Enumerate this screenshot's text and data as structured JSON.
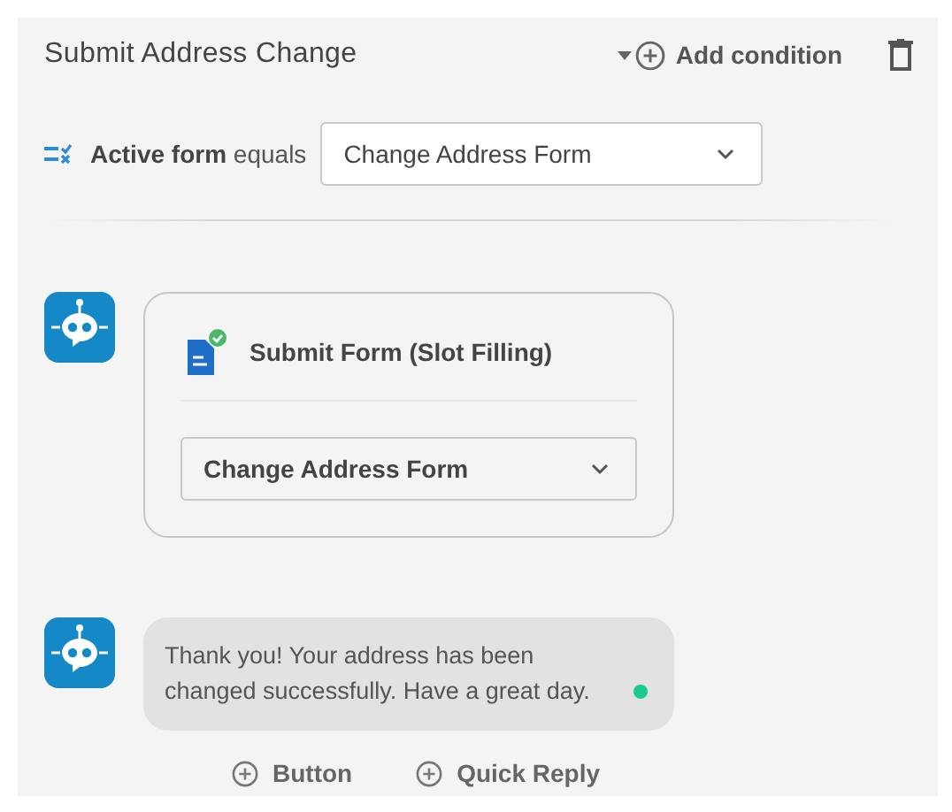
{
  "header": {
    "title": "Submit Address Change",
    "add_condition": "Add condition"
  },
  "condition": {
    "field": "Active form",
    "operator": "equals",
    "value": "Change Address Form"
  },
  "form_card": {
    "title": "Submit Form (Slot Filling)",
    "form": "Change Address Form"
  },
  "message": {
    "text": "Thank you! Your address has been changed successfully. Have a great day."
  },
  "actions": [
    "Button",
    "Quick Reply"
  ]
}
